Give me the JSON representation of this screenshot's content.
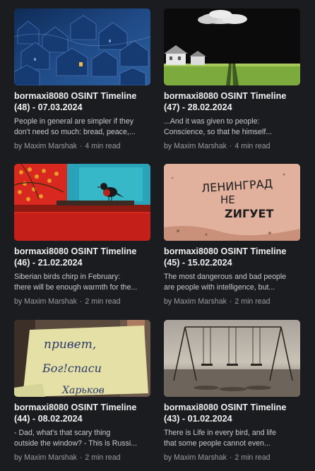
{
  "cards": [
    {
      "title_line1": "bormaxi8080 OSINT Timeline",
      "title_line2": "(48) - 07.03.2024",
      "excerpt_line1": "People in general are simpler if they",
      "excerpt_line2": "don't need so much: bread, peace,...",
      "author": "by Maxim Marshak",
      "read_time": "4 min read",
      "image": "night-city-painting"
    },
    {
      "title_line1": "bormaxi8080 OSINT Timeline",
      "title_line2": "(47) - 28.02.2024",
      "excerpt_line1": "...And it was given to people:",
      "excerpt_line2": "Conscience, so that he himself...",
      "author": "by Maxim Marshak",
      "read_time": "4 min read",
      "image": "house-field-cloud"
    },
    {
      "title_line1": "bormaxi8080 OSINT Timeline",
      "title_line2": "(46) - 21.02.2024",
      "excerpt_line1": "Siberian birds chirp in February:",
      "excerpt_line2": "there will be enough warmth for the...",
      "author": "by Maxim Marshak",
      "read_time": "2 min read",
      "image": "bird-on-red-wall"
    },
    {
      "title_line1": "bormaxi8080 OSINT Timeline",
      "title_line2": "(45) - 15.02.2024",
      "excerpt_line1": "The most dangerous and bad people",
      "excerpt_line2": "are people with intelligence, but...",
      "author": "by Maxim Marshak",
      "read_time": "2 min read",
      "image": "graffiti-wall",
      "graffiti_1": "ЛЕНИНГРАД",
      "graffiti_2": "НЕ",
      "graffiti_3": "ZИГУЕТ"
    },
    {
      "title_line1": "bormaxi8080 OSINT Timeline",
      "title_line2": "(44) - 08.02.2024",
      "excerpt_line1": "- Dad, what's that scary thing",
      "excerpt_line2": "outside the window? - This is Russi...",
      "author": "by Maxim Marshak",
      "read_time": "2 min read",
      "image": "handwritten-note",
      "note_1": "привет,",
      "note_2": "Бог!спаси",
      "note_3": "Харьков"
    },
    {
      "title_line1": "bormaxi8080 OSINT Timeline",
      "title_line2": "(43) - 01.02.2024",
      "excerpt_line1": "There is Life in every bird, and life",
      "excerpt_line2": "that some people cannot even...",
      "author": "by Maxim Marshak",
      "read_time": "2 min read",
      "image": "empty-swings"
    }
  ],
  "separator": "·",
  "colors": {
    "background": "#1b1c1f",
    "title": "#f0f0f0",
    "excerpt": "#c9c9c9",
    "meta": "#9c9c9c"
  }
}
